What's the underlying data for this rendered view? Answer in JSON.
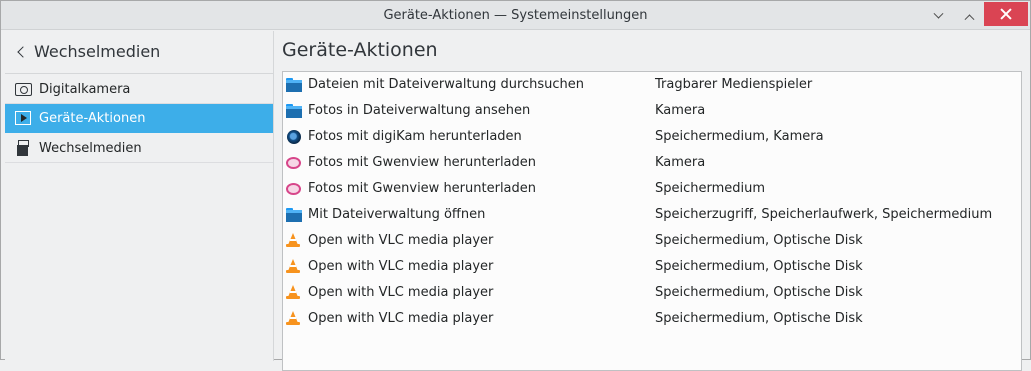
{
  "window": {
    "title": "Geräte-Aktionen — Systemeinstellungen"
  },
  "sidebar": {
    "title": "Wechselmedien",
    "items": [
      {
        "label": "Digitalkamera",
        "icon": "camera-icon",
        "active": false
      },
      {
        "label": "Geräte-Aktionen",
        "icon": "play-icon",
        "active": true
      },
      {
        "label": "Wechselmedien",
        "icon": "usb-icon",
        "active": false
      }
    ]
  },
  "main": {
    "title": "Geräte-Aktionen",
    "rows": [
      {
        "name": "Dateien mit Dateiverwaltung durchsuchen",
        "type": "Tragbarer Medienspieler",
        "icon": "folder-icon"
      },
      {
        "name": "Fotos in Dateiverwaltung ansehen",
        "type": "Kamera",
        "icon": "folder-icon"
      },
      {
        "name": "Fotos mit digiKam herunterladen",
        "type": "Speichermedium, Kamera",
        "icon": "digikam-icon"
      },
      {
        "name": "Fotos mit Gwenview herunterladen",
        "type": "Kamera",
        "icon": "gwenview-icon"
      },
      {
        "name": "Fotos mit Gwenview herunterladen",
        "type": "Speichermedium",
        "icon": "gwenview-icon"
      },
      {
        "name": "Mit Dateiverwaltung öffnen",
        "type": "Speicherzugriff, Speicherlaufwerk, Speichermedium",
        "icon": "folder-icon"
      },
      {
        "name": "Open with VLC media player",
        "type": "Speichermedium, Optische Disk",
        "icon": "vlc-icon"
      },
      {
        "name": "Open with VLC media player",
        "type": "Speichermedium, Optische Disk",
        "icon": "vlc-icon"
      },
      {
        "name": "Open with VLC media player",
        "type": "Speichermedium, Optische Disk",
        "icon": "vlc-icon"
      },
      {
        "name": "Open with VLC media player",
        "type": "Speichermedium, Optische Disk",
        "icon": "vlc-icon"
      }
    ]
  },
  "colors": {
    "accent": "#3daee9",
    "close": "#da4453"
  }
}
